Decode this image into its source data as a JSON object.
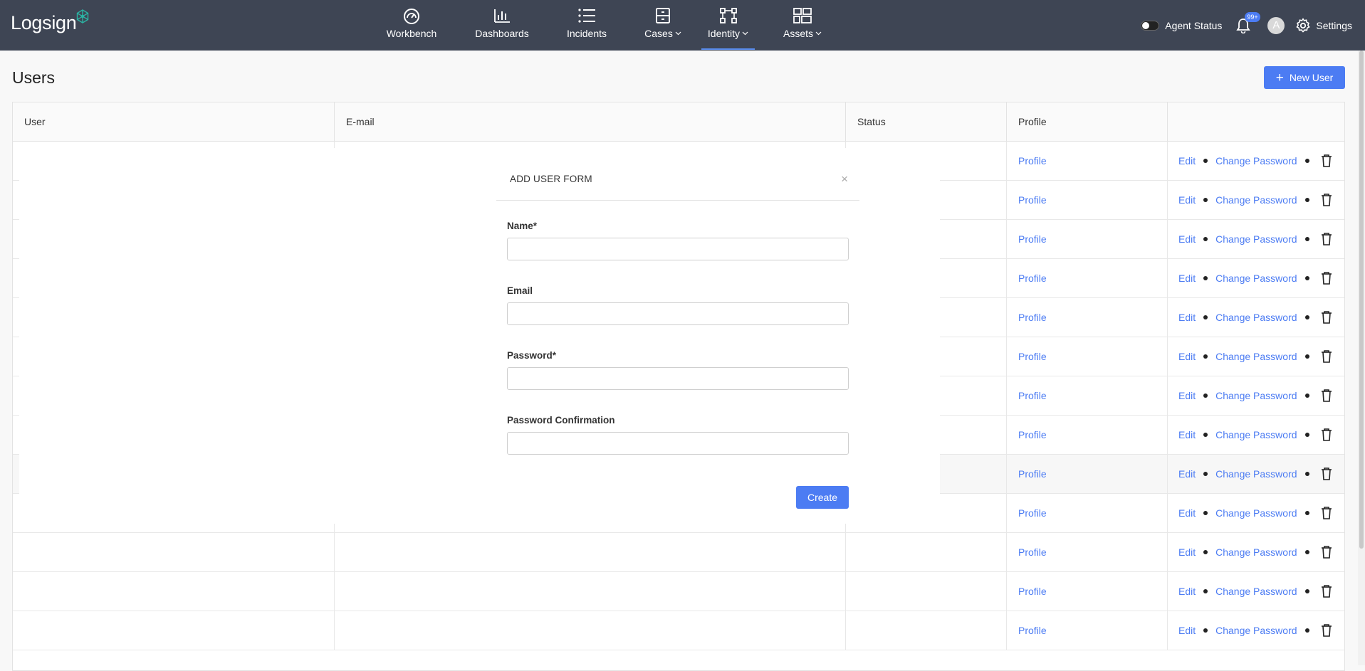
{
  "app": {
    "logo_text": "Logsign"
  },
  "nav": {
    "items": [
      {
        "label": "Workbench",
        "icon": "gauge-icon",
        "dropdown": false
      },
      {
        "label": "Dashboards",
        "icon": "bar-chart-icon",
        "dropdown": false
      },
      {
        "label": "Incidents",
        "icon": "list-icon",
        "dropdown": false
      },
      {
        "label": "Cases",
        "icon": "cabinet-icon",
        "dropdown": true
      },
      {
        "label": "Identity",
        "icon": "network-icon",
        "dropdown": true,
        "active": true
      },
      {
        "label": "Assets",
        "icon": "grid-icon",
        "dropdown": true
      }
    ]
  },
  "toolbar": {
    "agent_status_label": "Agent Status",
    "notification_badge": "99+",
    "avatar_letter": "A",
    "settings_label": "Settings"
  },
  "page": {
    "title": "Users",
    "new_user_label": "New User"
  },
  "table": {
    "columns": [
      "User",
      "E-mail",
      "Status",
      "Profile",
      ""
    ],
    "row_profile_label": "Profile",
    "row_edit_label": "Edit",
    "row_change_password_label": "Change Password",
    "row_count": 13
  },
  "modal": {
    "title": "ADD USER FORM",
    "close_glyph": "×",
    "fields": [
      {
        "label": "Name*",
        "value": "",
        "type": "text"
      },
      {
        "label": "Email",
        "value": "",
        "type": "email"
      },
      {
        "label": "Password*",
        "value": "",
        "type": "password"
      },
      {
        "label": "Password Confirmation",
        "value": "",
        "type": "password"
      }
    ],
    "submit_label": "Create"
  },
  "colors": {
    "topbar": "#3e4554",
    "accent": "#4c7cf3",
    "logo_mark": "#2bb3a3"
  }
}
